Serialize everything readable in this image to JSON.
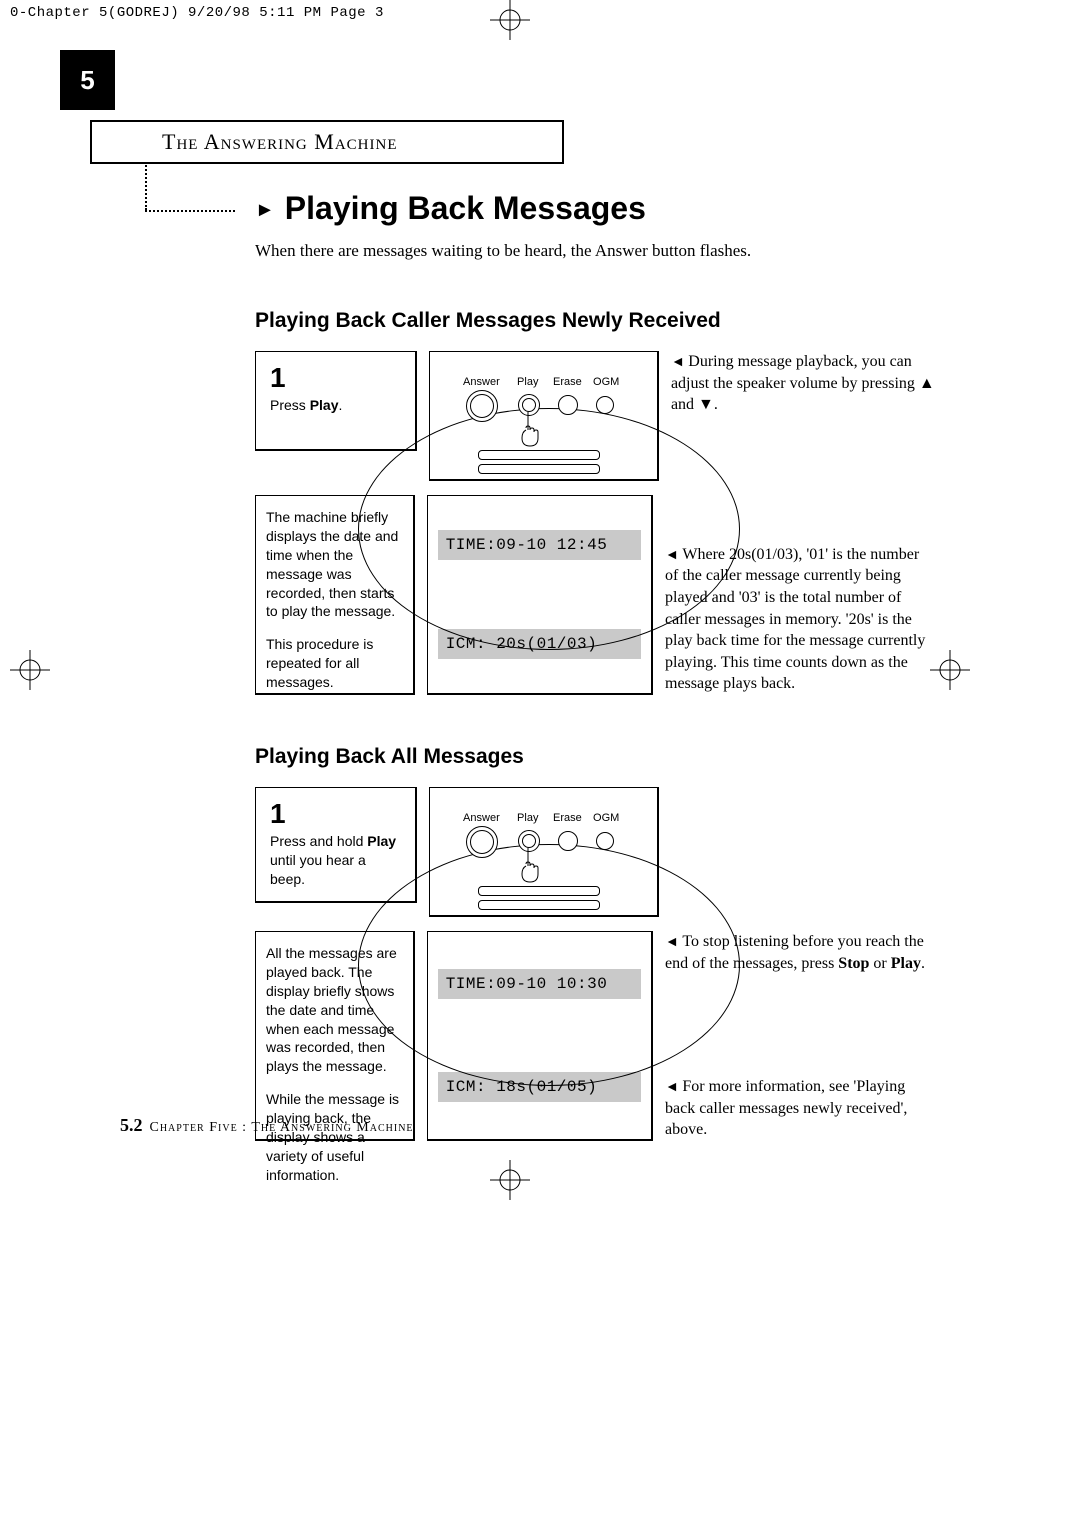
{
  "prepress": "0-Chapter 5(GODREJ)  9/20/98 5:11 PM  Page 3",
  "chapter_number": "5",
  "section_title": "The  Answering  Machine",
  "main_title": "Playing Back Messages",
  "intro": "When there are messages waiting to be heard, the Answer button flashes.",
  "section1": {
    "heading": "Playing Back Caller Messages Newly Received",
    "step1_num": "1",
    "step1_txt_a": "Press ",
    "step1_txt_b": "Play",
    "step1_txt_c": ".",
    "note1": "During message playback, you can adjust the speaker volume by pressing ▲ and ▼.",
    "disp_txt1": "The machine briefly displays the date and time when the message was recorded, then starts to play the message.",
    "disp_txt2": "This procedure is repeated for all messages.",
    "lcd1": "TIME:09-10 12:45",
    "lcd2": "ICM: 20s(01/03)",
    "note2": "Where 20s(01/03), '01' is the number of the caller message currently being played and '03' is the total number of caller messages in memory. '20s' is the play back time for the message currently playing. This time counts down as the message plays back."
  },
  "section2": {
    "heading": "Playing Back All Messages",
    "step1_num": "1",
    "step1_txt_a": "Press and hold ",
    "step1_txt_b": "Play",
    "step1_txt_c": " until you hear a beep.",
    "disp_txt1": "All the messages are played back. The display briefly shows the date and time when each message was recorded, then plays the message.",
    "disp_txt2": "While the message is playing back, the display shows a variety of useful information.",
    "lcd1": "TIME:09-10 10:30",
    "lcd2": "ICM: 18s(01/05)",
    "note1_a": "To stop listening before you reach the end of the messages, press ",
    "note1_b": "Stop",
    "note1_c": " or ",
    "note1_d": "Play",
    "note1_e": ".",
    "note2": "For more information, see 'Playing back caller messages newly received', above."
  },
  "diagram": {
    "labels": {
      "answer": "Answer",
      "play": "Play",
      "erase": "Erase",
      "ogm": "OGM"
    }
  },
  "footer": {
    "page": "5.2",
    "text": "Chapter Five :  The  Answering  Machine"
  }
}
